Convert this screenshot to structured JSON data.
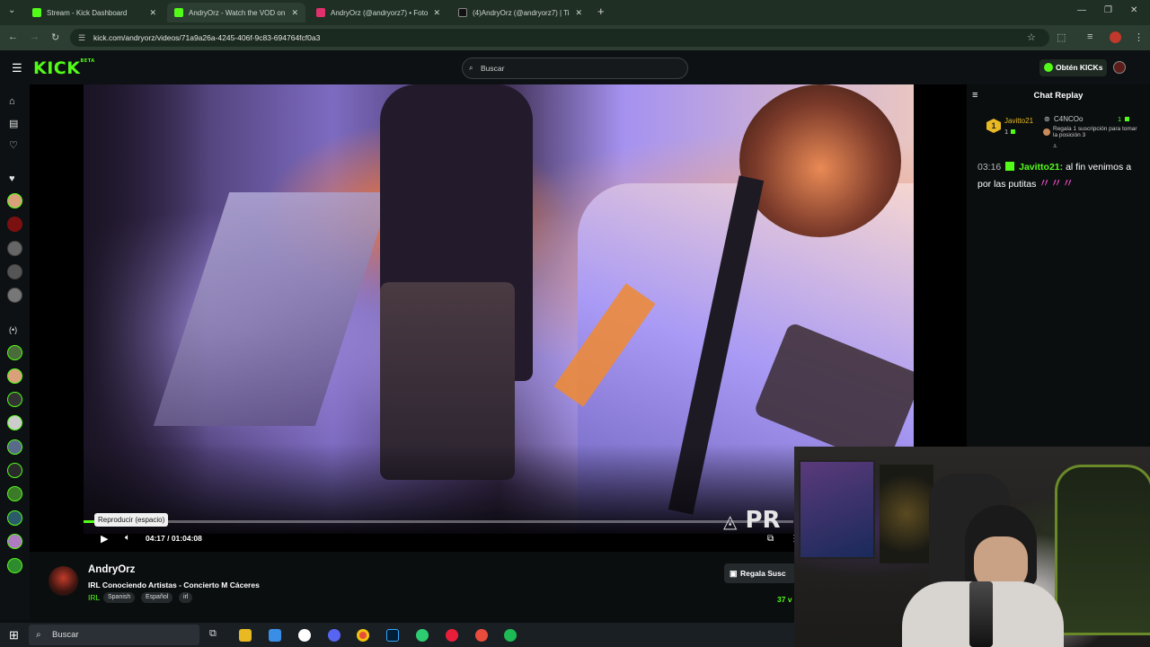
{
  "browser": {
    "tabs": [
      {
        "label": "Stream - Kick Dashboard",
        "favicon_color": "#53fc18"
      },
      {
        "label": "AndryOrz - Watch the VOD on",
        "favicon_color": "#53fc18"
      },
      {
        "label": "AndryOrz (@andryorz7) • Foto",
        "favicon_color": "#e1306c"
      },
      {
        "label": "(4)AndryOrz (@andryorz7) | Tik",
        "favicon_color": "#111111"
      }
    ],
    "url": "kick.com/andryorz/videos/71a9a26a-4245-406f-9c83-694764fcf0a3"
  },
  "header": {
    "logo": "KICK",
    "logo_badge": "BETA",
    "search_placeholder": "Buscar",
    "kicks_button": "Obtén KICKs"
  },
  "player": {
    "tooltip": "Reproducir (espacio)",
    "time": "04:17 / 01:04:08",
    "progress_fraction": 0.067,
    "watermark": "PR"
  },
  "chat": {
    "title": "Chat Replay",
    "leader_rank": "1",
    "leader_name": "Javitto21",
    "leader_count": "1",
    "gifter_name": "C4NCOo",
    "gifter_count": "1",
    "gift_cta": "Regala 1 suscripción para tomar la posición 3",
    "message": {
      "timestamp": "03:16",
      "user": "Javitto21:",
      "text": "al fin venimos a por las putitas"
    }
  },
  "stream": {
    "name": "AndryOrz",
    "title": "IRL Conociendo Artistas - Concierto M Cáceres",
    "category": "IRL",
    "tags": [
      "Spanish",
      "Español",
      "irl"
    ],
    "gift_button": "Regala Susc",
    "viewers": "37 v"
  },
  "taskbar": {
    "search": "Buscar"
  },
  "colors": {
    "accent": "#53fc18"
  }
}
